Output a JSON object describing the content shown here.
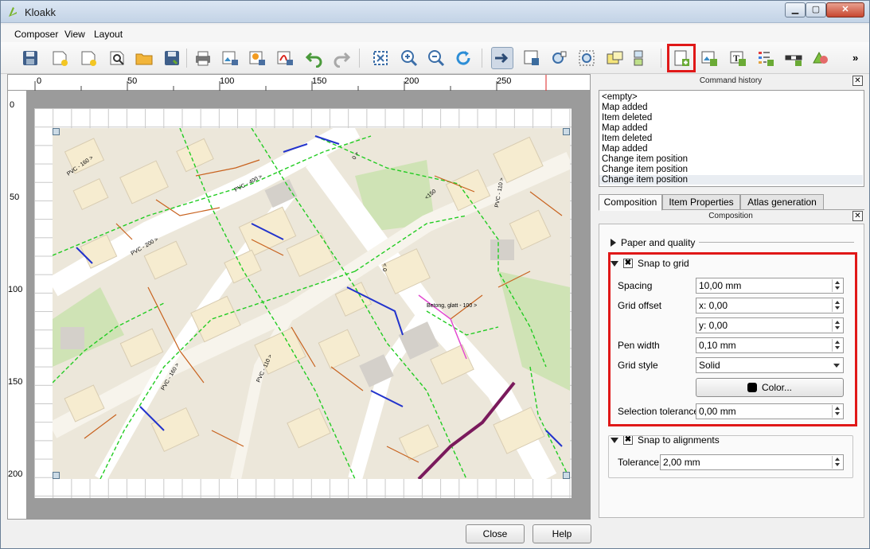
{
  "window": {
    "title": "Kloakk",
    "min": "▁",
    "max": "▢",
    "close": "✕"
  },
  "menu": [
    "Composer",
    "View",
    "Layout"
  ],
  "toolbar": {
    "icons": [
      "save-icon",
      "new-composer-icon",
      "duplicate-composer-icon",
      "composer-manager-icon",
      "open-template-icon",
      "save-template-icon",
      "print-icon",
      "export-image-icon",
      "export-svg-icon",
      "export-pdf-icon",
      "undo-icon",
      "redo-icon",
      "zoom-full-icon",
      "zoom-in-icon",
      "zoom-out-icon",
      "refresh-icon",
      "select-move-item-icon",
      "move-item-content-icon",
      "pan-icon",
      "zoom-tool-icon",
      "select-icon",
      "group-icon",
      "add-map-icon",
      "add-image-icon",
      "add-label-icon",
      "add-legend-icon",
      "add-scalebar-icon",
      "add-shape-icon"
    ],
    "more": "»"
  },
  "ruler": {
    "h": [
      "0",
      "50",
      "100",
      "150",
      "200",
      "250"
    ],
    "v": [
      "0",
      "50",
      "100",
      "150",
      "200"
    ]
  },
  "history": {
    "title": "Command history",
    "close": "✕",
    "items": [
      "<empty>",
      "Map added",
      "Item deleted",
      "Map added",
      "Item deleted",
      "Map added",
      "Change item position",
      "Change item position",
      "Change item position"
    ]
  },
  "tabs": [
    "Composition",
    "Item Properties",
    "Atlas generation"
  ],
  "composition": {
    "title": "Composition",
    "close": "✕",
    "paper_section": "Paper and quality",
    "snap_grid": {
      "label": "Snap to grid",
      "checked": "✖",
      "spacing_label": "Spacing",
      "spacing": "10,00 mm",
      "offset_label": "Grid offset",
      "offset_x": "x: 0,00",
      "offset_y": "y: 0,00",
      "pen_label": "Pen width",
      "pen": "0,10 mm",
      "style_label": "Grid style",
      "style": "Solid",
      "color_button": "Color...",
      "tolerance_label": "Selection tolerance",
      "tolerance": "0,00 mm"
    },
    "snap_align": {
      "label": "Snap to alignments",
      "checked": "✖",
      "tolerance_label": "Tolerance",
      "tolerance": "2,00 mm"
    }
  },
  "buttons": {
    "close": "Close",
    "help": "Help"
  },
  "map_labels": [
    "PVC - 160 >",
    "PVC - 110 >",
    "PVC - 200 >",
    "PVC - 400 >",
    "Betong, glatt - 100 >",
    "<150",
    "0 >"
  ],
  "colors": {
    "highlight": "#e01818",
    "sewer_green": "#22cc22",
    "pipe_orange": "#c8621e",
    "pipe_blue": "#2233cc"
  }
}
